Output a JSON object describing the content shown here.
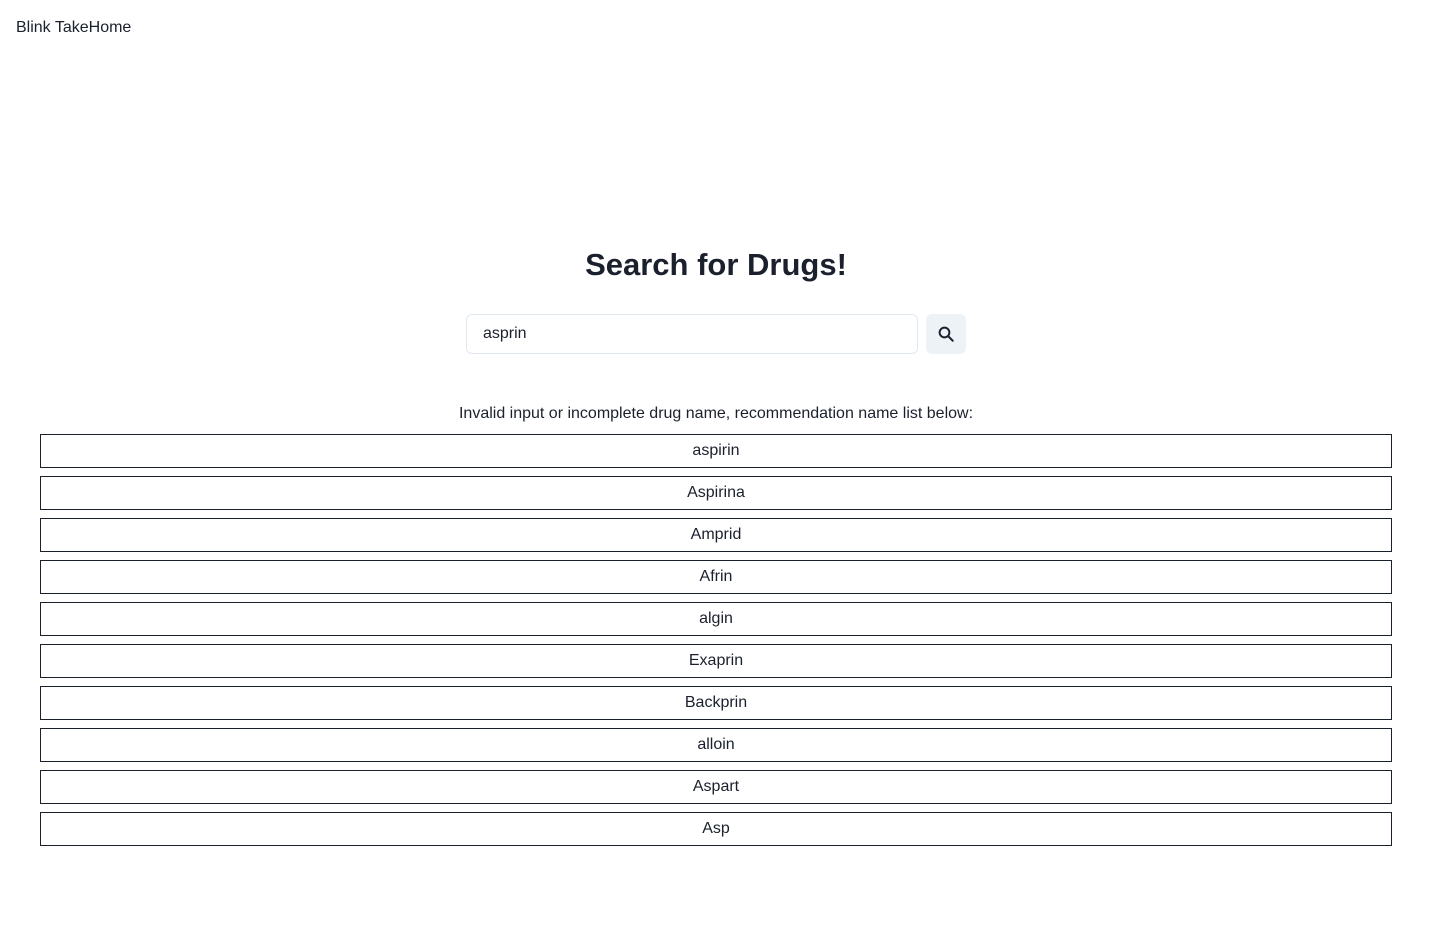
{
  "header": {
    "brand": "Blink TakeHome"
  },
  "main": {
    "title": "Search for Drugs!",
    "search": {
      "value": "asprin",
      "icon": "search-icon",
      "button_color": "#edf2f7"
    },
    "notice": "Invalid input or incomplete drug name, recommendation name list below:",
    "recommendations": [
      "aspirin",
      "Aspirina",
      "Amprid",
      "Afrin",
      "algin",
      "Exaprin",
      "Backprin",
      "alloin",
      "Aspart",
      "Asp"
    ]
  }
}
